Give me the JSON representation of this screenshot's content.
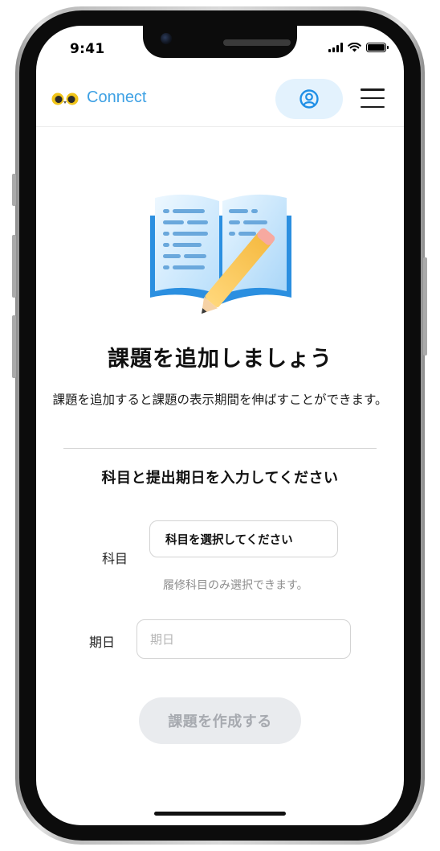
{
  "status_bar": {
    "time": "9:41"
  },
  "header": {
    "brand": "Connect",
    "profile_icon": "user-circle-icon",
    "menu_icon": "hamburger-menu-icon",
    "accent_color": "#3ea1e4"
  },
  "hero": {
    "illustration": "open-book-with-pencil",
    "title": "課題を追加しましょう",
    "description": "課題を追加すると課題の表示期間を伸ばすことができます。"
  },
  "form": {
    "heading": "科目と提出期日を入力してください",
    "subject_label": "科目",
    "subject_value": "科目を選択してください",
    "subject_hint": "履修科目のみ選択できます。",
    "date_label": "期日",
    "date_placeholder": "期日",
    "date_value": "",
    "submit_label": "課題を作成する"
  }
}
